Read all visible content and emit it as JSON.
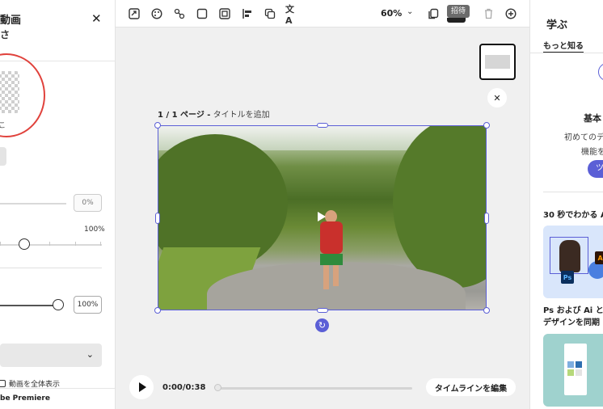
{
  "left_panel": {
    "title": "動画",
    "subtitle": "さ",
    "thumb_label": "こ",
    "opacity_value": "0%",
    "slider_max_label": "100%",
    "volume_value": "100%",
    "fullscreen_label": "動画を全体表示",
    "premiere_label": "be Premiere"
  },
  "toolbar": {
    "zoom": "60%",
    "invite_label": "招待"
  },
  "canvas": {
    "page_label_bold": "1 / 1 ページ -",
    "page_label_rest": " タイトルを追加"
  },
  "playback": {
    "timecode": "0:00/0:38",
    "edit_timeline_label": "タイムラインを編集",
    "progress": 0
  },
  "right_panel": {
    "title": "学ぶ",
    "tab_more": "もっと知る",
    "basic": "基本",
    "first_line": "初めてのデ",
    "func_line": "機能を",
    "pill_label": "ツ",
    "section_30s": "30 秒でわかる A",
    "card1_caption_line1": "Ps および Ai と",
    "card1_caption_line2": "デザインを同期",
    "ps_badge": "Ps",
    "ai_badge": "Ai"
  },
  "colors": {
    "accent": "#5b5fd6",
    "annotation_red": "#e0423c"
  }
}
